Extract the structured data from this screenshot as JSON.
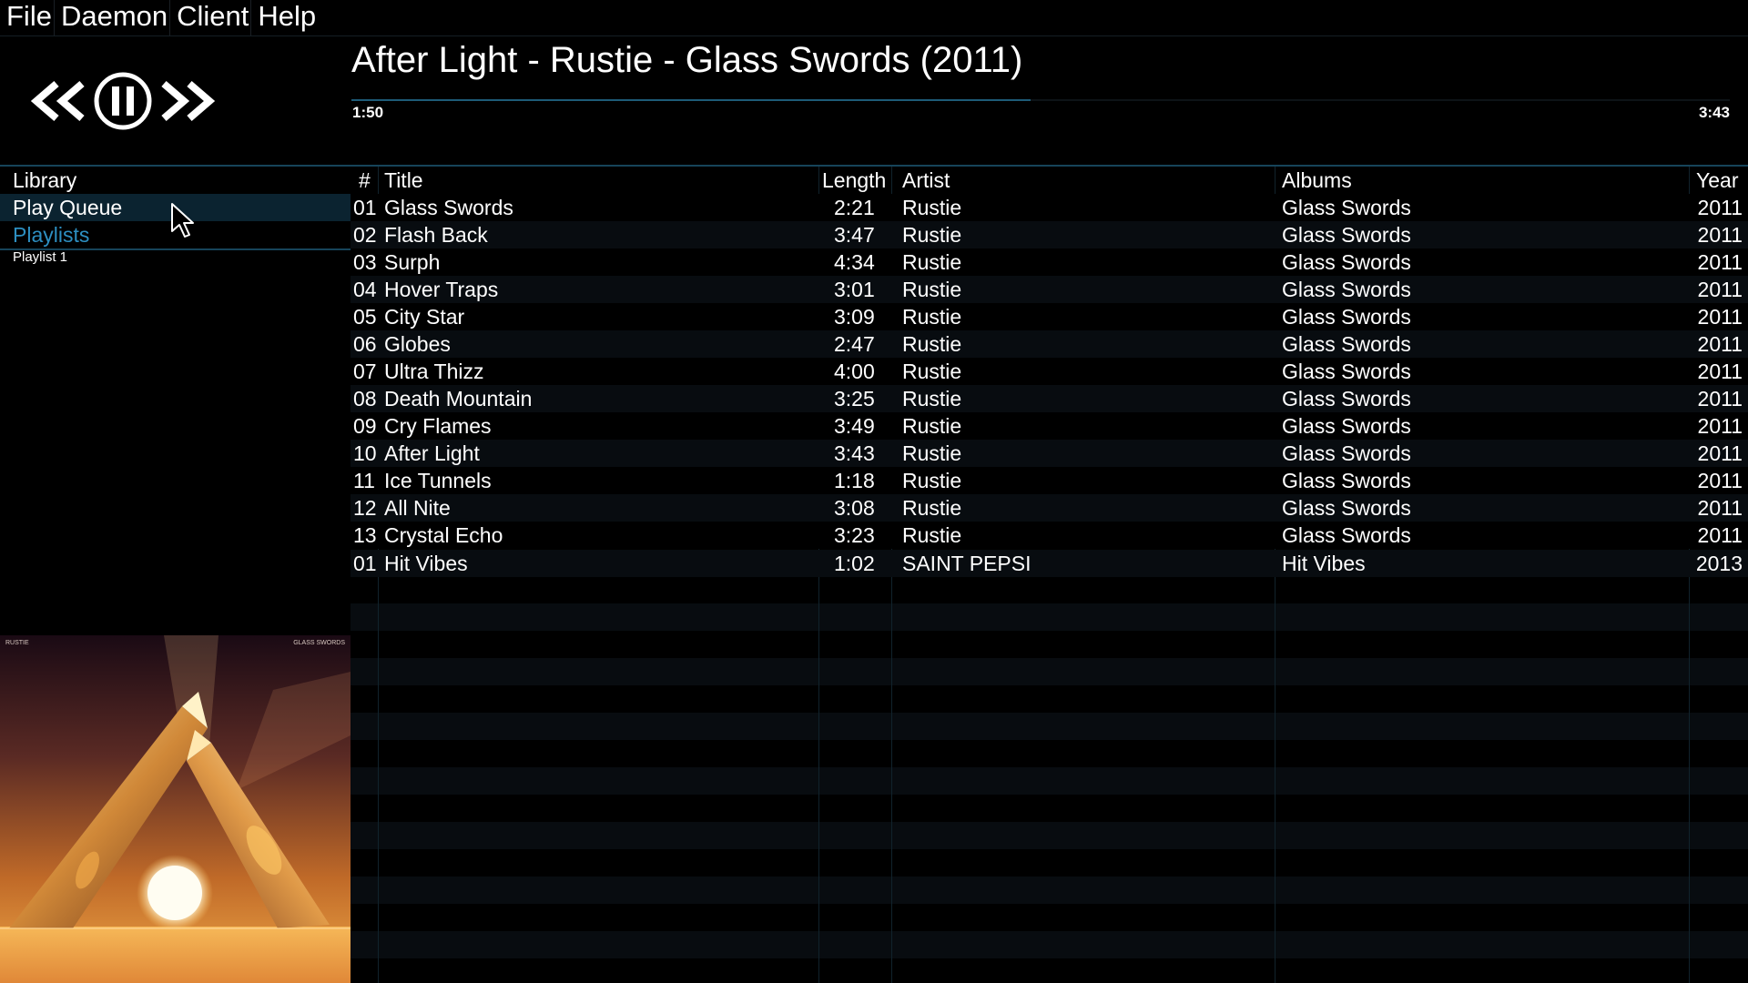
{
  "menu": [
    "File",
    "Daemon",
    "Client",
    "Help"
  ],
  "now_playing": {
    "title": "After Light - Rustie - Glass Swords (2011)",
    "elapsed": "1:50",
    "total": "3:43",
    "progress": 0.493
  },
  "sidebar": {
    "items": [
      {
        "label": "Library"
      },
      {
        "label": "Play Queue"
      },
      {
        "label": "Playlists"
      },
      {
        "label": "Playlist 1"
      }
    ]
  },
  "album_art": {
    "left_text": "RUSTIE",
    "right_text": "GLASS SWORDS"
  },
  "table": {
    "columns": [
      "#",
      "Title",
      "Length",
      "Artist",
      "Albums",
      "Year"
    ],
    "rows": [
      [
        "01",
        "Glass Swords",
        "2:21",
        "Rustie",
        "Glass Swords",
        "2011"
      ],
      [
        "02",
        "Flash Back",
        "3:47",
        "Rustie",
        "Glass Swords",
        "2011"
      ],
      [
        "03",
        "Surph",
        "4:34",
        "Rustie",
        "Glass Swords",
        "2011"
      ],
      [
        "04",
        "Hover Traps",
        "3:01",
        "Rustie",
        "Glass Swords",
        "2011"
      ],
      [
        "05",
        "City Star",
        "3:09",
        "Rustie",
        "Glass Swords",
        "2011"
      ],
      [
        "06",
        "Globes",
        "2:47",
        "Rustie",
        "Glass Swords",
        "2011"
      ],
      [
        "07",
        "Ultra Thizz",
        "4:00",
        "Rustie",
        "Glass Swords",
        "2011"
      ],
      [
        "08",
        "Death Mountain",
        "3:25",
        "Rustie",
        "Glass Swords",
        "2011"
      ],
      [
        "09",
        "Cry Flames",
        "3:49",
        "Rustie",
        "Glass Swords",
        "2011"
      ],
      [
        "10",
        "After Light",
        "3:43",
        "Rustie",
        "Glass Swords",
        "2011"
      ],
      [
        "11",
        "Ice Tunnels",
        "1:18",
        "Rustie",
        "Glass Swords",
        "2011"
      ],
      [
        "12",
        "All Nite",
        "3:08",
        "Rustie",
        "Glass Swords",
        "2011"
      ],
      [
        "13",
        "Crystal Echo",
        "3:23",
        "Rustie",
        "Glass Swords",
        "2011"
      ],
      [
        "01",
        "Hit Vibes",
        "1:02",
        "SAINT PEPSI",
        "Hit Vibes",
        "2013"
      ]
    ]
  },
  "colors": {
    "accent": "#2d8fc1",
    "separator": "#16445a",
    "selection": "#0b2330"
  },
  "icons": [
    "previous-icon",
    "pause-icon",
    "next-icon",
    "mouse-cursor-icon"
  ]
}
